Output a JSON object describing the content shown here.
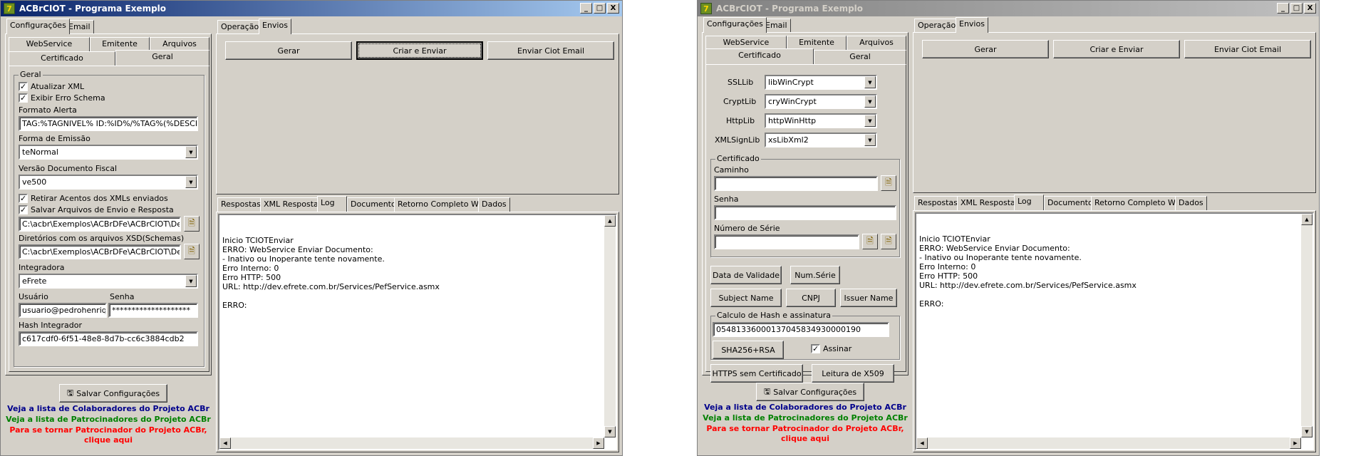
{
  "window_title": "ACBrCIOT - Programa Exemplo",
  "title_buttons": {
    "min": "_",
    "max": "□",
    "close": "X"
  },
  "left_tabs": {
    "config": "Configurações",
    "email": "Email"
  },
  "sub_tabs": {
    "webservice": "WebService",
    "emitente": "Emitente",
    "arquivos": "Arquivos",
    "certificado": "Certificado",
    "geral": "Geral"
  },
  "geral": {
    "group": "Geral",
    "atualizar_xml": "Atualizar XML",
    "exibir_erro": "Exibir Erro Schema",
    "formato_alerta_label": "Formato Alerta",
    "formato_alerta_value": "TAG:%TAGNIVEL% ID:%ID%/%TAG%(%DESCRI",
    "forma_emissao_label": "Forma de Emissão",
    "forma_emissao_value": "teNormal",
    "versao_label": "Versão Documento Fiscal",
    "versao_value": "ve500",
    "retirar_acentos": "Retirar Acentos dos XMLs enviados",
    "salvar_arquivos": "Salvar Arquivos de Envio e Resposta",
    "path1": "C:\\acbr\\Exemplos\\ACBrDFe\\ACBrCIOT\\Delphi\\",
    "xsd_label": "Diretórios com os arquivos XSD(Schemas)",
    "path2": "C:\\acbr\\Exemplos\\ACBrDFe\\ACBrCIOT\\Delphi\\",
    "integradora_label": "Integradora",
    "integradora_value": "eFrete",
    "usuario_label": "Usuário",
    "usuario_value": "usuario@pedrohenriquez",
    "senha_label": "Senha",
    "senha_value": "********************",
    "hash_label": "Hash Integrador",
    "hash_value": "c617cdf0-6f51-48e8-8d7b-cc6c3884cdb2"
  },
  "cert": {
    "ssllib_label": "SSLLib",
    "ssllib_value": "libWinCrypt",
    "cryptlib_label": "CryptLib",
    "cryptlib_value": "cryWinCrypt",
    "httplib_label": "HttpLib",
    "httplib_value": "httpWinHttp",
    "xmlsign_label": "XMLSignLib",
    "xmlsign_value": "xsLibXml2",
    "group": "Certificado",
    "caminho_label": "Caminho",
    "senha_label": "Senha",
    "serie_label": "Número de Série",
    "btn_validade": "Data de Validade",
    "btn_numserie": "Num.Série",
    "btn_subject": "Subject Name",
    "btn_cnpj": "CNPJ",
    "btn_issuer": "Issuer Name",
    "hash_group": "Calculo de Hash e assinatura",
    "hash_value": "05481336000137045834930000190",
    "btn_sha": "SHA256+RSA",
    "assinar": "Assinar",
    "btn_https": "HTTPS sem Certificado",
    "btn_x509": "Leitura de X509"
  },
  "salvar_btn": "Salvar Configurações",
  "links": {
    "colaboradores": "Veja a lista de Colaboradores do Projeto ACBr",
    "patrocinadores": "Veja a lista de Patrocinadores do Projeto ACBr",
    "tornar1": "Para se tornar Patrocinador do Projeto ACBr,",
    "tornar2": "clique aqui"
  },
  "right_tabs": {
    "operacao": "Operação",
    "envios": "Envios"
  },
  "actions": {
    "gerar": "Gerar",
    "criar_enviar": "Criar e Enviar",
    "enviar_email": "Enviar Ciot Email"
  },
  "log_tabs": {
    "respostas": "Respostas",
    "xml_resposta": "XML Resposta",
    "log": "Log",
    "documento": "Documento",
    "retorno": "Retorno Completo WS",
    "dados": "Dados"
  },
  "log_text": "Inicio TCIOTEnviar\nERRO: WebService Enviar Documento:\n- Inativo ou Inoperante tente novamente.\nErro Interno: 0\nErro HTTP: 500\nURL: http://dev.efrete.com.br/Services/PefService.asmx\n\nERRO:"
}
